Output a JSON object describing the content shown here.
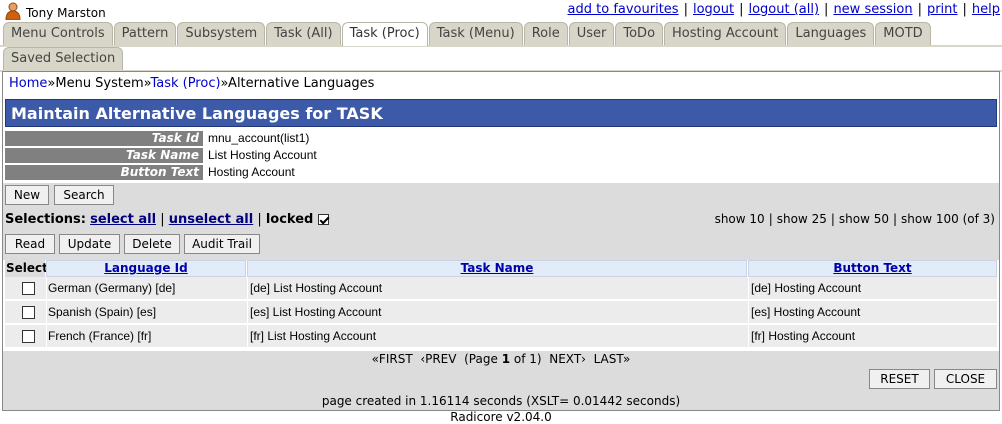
{
  "user": {
    "name": "Tony Marston",
    "icon": "user-icon"
  },
  "top_links": [
    "add to favourites",
    "logout",
    "logout (all)",
    "new session",
    "print",
    "help"
  ],
  "tabs_row1": [
    "Menu Controls",
    "Pattern",
    "Subsystem",
    "Task (All)",
    "Task (Proc)",
    "Task (Menu)",
    "Role",
    "User",
    "ToDo",
    "Hosting Account",
    "Languages",
    "MOTD"
  ],
  "tabs_row2": [
    "Saved Selection"
  ],
  "active_tab": "Task (Proc)",
  "breadcrumb": {
    "home": "Home",
    "sep": "»",
    "menu": "Menu System",
    "task": "Task (Proc)",
    "current": "Alternative Languages"
  },
  "title": "Maintain Alternative Languages for TASK",
  "details": [
    {
      "label": "Task Id",
      "value": "mnu_account(list1)"
    },
    {
      "label": "Task Name",
      "value": "List Hosting Account"
    },
    {
      "label": "Button Text",
      "value": "Hosting Account"
    }
  ],
  "buttons_top": {
    "new": "New",
    "search": "Search"
  },
  "selections": {
    "label": "Selections:",
    "select_all": "select all",
    "unselect_all": "unselect all",
    "locked": "locked",
    "locked_checked": true
  },
  "show": {
    "s10": "show 10",
    "s25": "show 25",
    "s50": "show 50",
    "s100": "show 100",
    "count": "(of 3)"
  },
  "buttons_mid": {
    "read": "Read",
    "update": "Update",
    "delete": "Delete",
    "audit": "Audit Trail"
  },
  "table": {
    "headers": {
      "select": "Select",
      "language_id": "Language Id",
      "task_name": "Task Name",
      "button_text": "Button Text"
    },
    "rows": [
      {
        "language": "German (Germany) [de]",
        "task_name": "[de] List Hosting Account",
        "button_text": "[de] Hosting Account"
      },
      {
        "language": "Spanish (Spain) [es]",
        "task_name": "[es] List Hosting Account",
        "button_text": "[es] Hosting Account"
      },
      {
        "language": "French (France) [fr]",
        "task_name": "[fr] List Hosting Account",
        "button_text": "[fr] Hosting Account"
      }
    ]
  },
  "pager": {
    "first": "«FIRST",
    "prev": "‹PREV",
    "page_pre": "(Page",
    "page": "1",
    "of": "of",
    "total": "1)",
    "next": "NEXT›",
    "last": "LAST»"
  },
  "buttons_bottom": {
    "reset": "RESET",
    "close": "CLOSE"
  },
  "footer": "page created in 1.16114 seconds (XSLT= 0.01442 seconds)",
  "version": "Radicore v2.04.0",
  "colors": {
    "title_bg": "#3c5aa8",
    "label_bg": "#808080",
    "tab_bg": "#d8d6c8",
    "link": "#0000cc"
  }
}
